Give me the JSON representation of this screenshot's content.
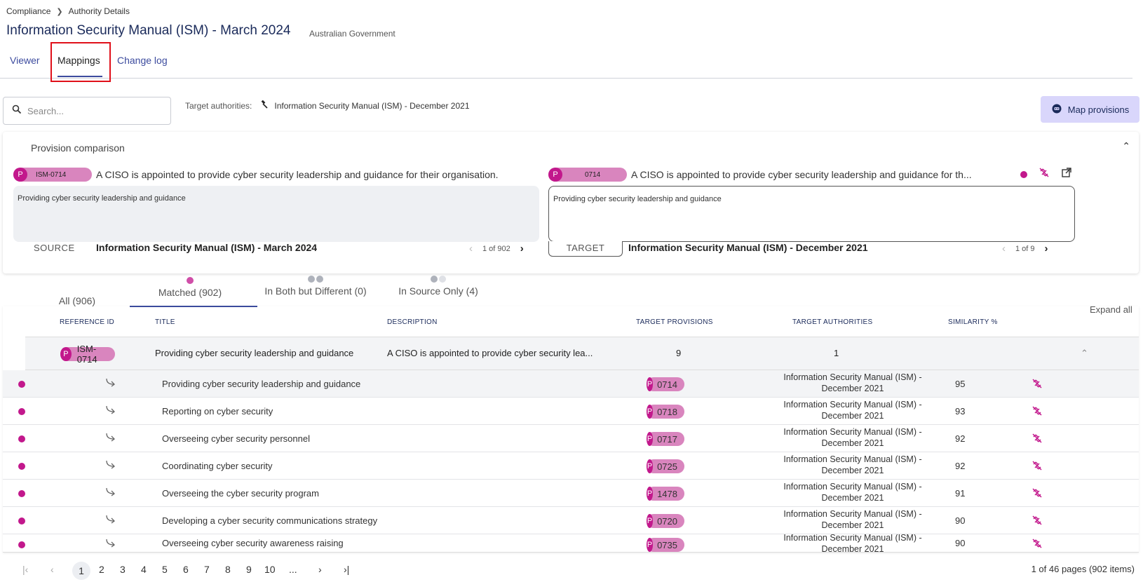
{
  "breadcrumb": {
    "root": "Compliance",
    "current": "Authority Details"
  },
  "page": {
    "title": "Information Security Manual (ISM) - March 2024",
    "subtitle": "Australian Government"
  },
  "tabs": [
    {
      "label": "Viewer"
    },
    {
      "label": "Mappings"
    },
    {
      "label": "Change log"
    }
  ],
  "toolbar": {
    "search_placeholder": "Search...",
    "target_label": "Target authorities:",
    "target_value": "Information Security Manual (ISM) - December 2021",
    "map_button": "Map provisions"
  },
  "comparison": {
    "title": "Provision comparison",
    "source": {
      "badge_letter": "P",
      "badge_id": "ISM-0714",
      "heading": "A CISO is appointed to provide cyber security leadership and guidance for their organisation.",
      "body": "Providing cyber security leadership and guidance",
      "label": "SOURCE",
      "authority": "Information Security Manual (ISM) - March 2024",
      "pager": "1 of 902"
    },
    "target": {
      "badge_letter": "P",
      "badge_id": "0714",
      "heading": "A CISO is appointed to provide cyber security leadership and guidance for th...",
      "body": "Providing cyber security leadership and guidance",
      "label": "TARGET",
      "authority": "Information Security Manual (ISM) - December 2021",
      "pager": "1 of 9"
    }
  },
  "filters": {
    "all": "All (906)",
    "matched": "Matched (902)",
    "both_different": "In Both but Different (0)",
    "source_only": "In Source Only (4)"
  },
  "table": {
    "expand_all": "Expand all",
    "headers": {
      "reference_id": "REFERENCE ID",
      "title": "TITLE",
      "description": "DESCRIPTION",
      "target_provisions": "TARGET PROVISIONS",
      "target_authorities": "TARGET AUTHORITIES",
      "similarity": "SIMILARITY %"
    },
    "group": {
      "badge_letter": "P",
      "badge_id": "ISM-0714",
      "title": "Providing cyber security leadership and guidance",
      "description": "A CISO is appointed to provide cyber security lea...",
      "target_provisions": "9",
      "target_authorities": "1"
    },
    "rows": [
      {
        "title": "Providing cyber security leadership and guidance",
        "badge_letter": "P",
        "badge_id": "0714",
        "auth1": "Information Security Manual (ISM) -",
        "auth2": "December 2021",
        "similarity": "95"
      },
      {
        "title": "Reporting on cyber security",
        "badge_letter": "P",
        "badge_id": "0718",
        "auth1": "Information Security Manual (ISM) -",
        "auth2": "December 2021",
        "similarity": "93"
      },
      {
        "title": "Overseeing cyber security personnel",
        "badge_letter": "P",
        "badge_id": "0717",
        "auth1": "Information Security Manual (ISM) -",
        "auth2": "December 2021",
        "similarity": "92"
      },
      {
        "title": "Coordinating cyber security",
        "badge_letter": "P",
        "badge_id": "0725",
        "auth1": "Information Security Manual (ISM) -",
        "auth2": "December 2021",
        "similarity": "92"
      },
      {
        "title": "Overseeing the cyber security program",
        "badge_letter": "P",
        "badge_id": "1478",
        "auth1": "Information Security Manual (ISM) -",
        "auth2": "December 2021",
        "similarity": "91"
      },
      {
        "title": "Developing a cyber security communications strategy",
        "badge_letter": "P",
        "badge_id": "0720",
        "auth1": "Information Security Manual (ISM) -",
        "auth2": "December 2021",
        "similarity": "90"
      },
      {
        "title": "Overseeing cyber security awareness raising",
        "badge_letter": "P",
        "badge_id": "0735",
        "auth1": "Information Security Manual (ISM) -",
        "auth2": "December 2021",
        "similarity": "90"
      }
    ]
  },
  "pagination": {
    "pages": [
      "1",
      "2",
      "3",
      "4",
      "5",
      "6",
      "7",
      "8",
      "9",
      "10",
      "..."
    ],
    "info": "1 of 46 pages (902 items)"
  },
  "colors": {
    "accent": "#c2188c",
    "badge": "#d985be",
    "primary": "#3c4b9e",
    "map_button_bg": "#d9d6fb",
    "highlight": "#e0101a"
  }
}
